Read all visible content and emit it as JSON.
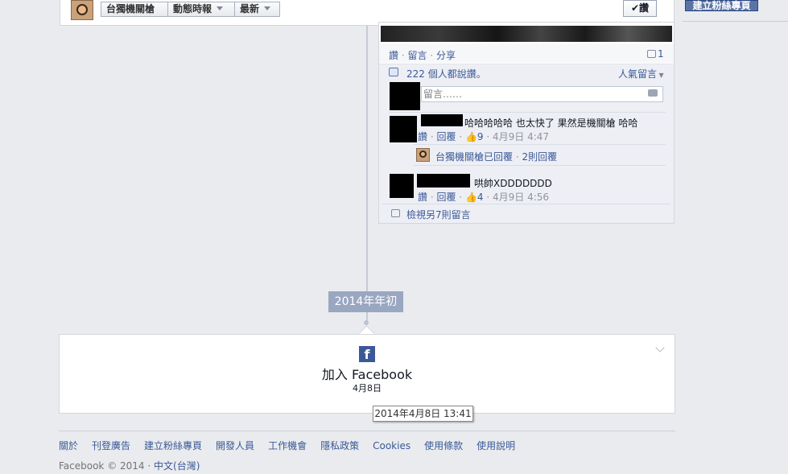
{
  "header": {
    "page_name": "台獨機關槍",
    "feed_dropdown": "動態時報",
    "sort_dropdown": "最新",
    "like_button": "讚",
    "create_page": "建立粉絲專頁"
  },
  "story": {
    "actions": {
      "like": "讚",
      "comment": "留言",
      "share": "分享"
    },
    "share_count": "1",
    "likes_text": "222 個人都說讚。",
    "popular_comments": "人氣留言",
    "comment_placeholder": "留言……",
    "comments": [
      {
        "text": "哈哈哈哈哈 也太快了 果然是機關槍 哈哈",
        "like": "讚",
        "reply": "回覆",
        "like_count": "9",
        "time": "4月9日 4:47",
        "page_reply": {
          "name": "台獨機關槍",
          "status": "已回覆",
          "count": "2則回覆"
        }
      },
      {
        "text": "哄帥XDDDDDDD",
        "like": "讚",
        "reply": "回覆",
        "like_count": "4",
        "time": "4月9日 4:56"
      }
    ],
    "view_more": "檢視另7則留言"
  },
  "timeline": {
    "year_marker": "2014年年初",
    "join_title": "加入 Facebook",
    "join_date": "4月8日",
    "tooltip": "2014年4月8日 13:41"
  },
  "footer": {
    "links": [
      "關於",
      "刊登廣告",
      "建立粉絲專頁",
      "開發人員",
      "工作機會",
      "隱私政策",
      "Cookies",
      "使用條款",
      "使用說明"
    ],
    "copyright": "Facebook © 2014",
    "separator": "·",
    "language": "中文(台灣)"
  },
  "colors": {
    "link": "#3b5998",
    "background": "#e9ebee",
    "marker": "#9aa7c1"
  }
}
